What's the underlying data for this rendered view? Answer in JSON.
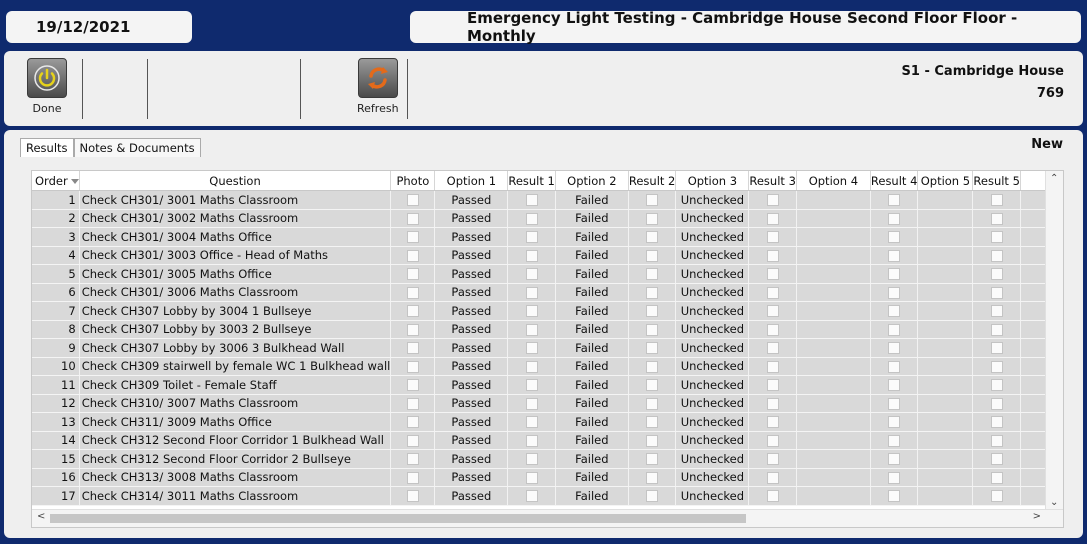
{
  "header": {
    "date": "19/12/2021",
    "title": "Emergency Light Testing - Cambridge House Second Floor Floor - Monthly"
  },
  "toolbar": {
    "done_label": "Done",
    "refresh_label": "Refresh",
    "site_name": "S1 - Cambridge House",
    "site_number": "769"
  },
  "tabs": [
    "Results",
    "Notes & Documents"
  ],
  "new_label": "New",
  "grid": {
    "columns": [
      "Order",
      "Question",
      "Photo",
      "Option 1",
      "Result 1",
      "Option 2",
      "Result 2",
      "Option 3",
      "Result 3",
      "Option 4",
      "Result 4",
      "Option 5",
      "Result 5"
    ],
    "rows": [
      {
        "order": "1",
        "question": "Check CH301/ 3001 Maths Classroom",
        "option1": "Passed",
        "option2": "Failed",
        "option3": "Unchecked"
      },
      {
        "order": "2",
        "question": "Check CH301/ 3002 Maths Classroom",
        "option1": "Passed",
        "option2": "Failed",
        "option3": "Unchecked"
      },
      {
        "order": "3",
        "question": "Check CH301/ 3004 Maths Office",
        "option1": "Passed",
        "option2": "Failed",
        "option3": "Unchecked"
      },
      {
        "order": "4",
        "question": "Check CH301/ 3003 Office - Head of Maths",
        "option1": "Passed",
        "option2": "Failed",
        "option3": "Unchecked"
      },
      {
        "order": "5",
        "question": "Check CH301/ 3005 Maths Office",
        "option1": "Passed",
        "option2": "Failed",
        "option3": "Unchecked"
      },
      {
        "order": "6",
        "question": "Check CH301/ 3006 Maths Classroom",
        "option1": "Passed",
        "option2": "Failed",
        "option3": "Unchecked"
      },
      {
        "order": "7",
        "question": "Check CH307 Lobby by 3004 1 Bullseye",
        "option1": "Passed",
        "option2": "Failed",
        "option3": "Unchecked"
      },
      {
        "order": "8",
        "question": "Check CH307 Lobby by 3003 2 Bullseye",
        "option1": "Passed",
        "option2": "Failed",
        "option3": "Unchecked"
      },
      {
        "order": "9",
        "question": "Check CH307 Lobby by 3006 3 Bulkhead Wall",
        "option1": "Passed",
        "option2": "Failed",
        "option3": "Unchecked"
      },
      {
        "order": "10",
        "question": "Check CH309 stairwell by female  WC 1 Bulkhead wall",
        "option1": "Passed",
        "option2": "Failed",
        "option3": "Unchecked"
      },
      {
        "order": "11",
        "question": "Check CH309 Toilet - Female Staff",
        "option1": "Passed",
        "option2": "Failed",
        "option3": "Unchecked"
      },
      {
        "order": "12",
        "question": "Check CH310/ 3007 Maths Classroom",
        "option1": "Passed",
        "option2": "Failed",
        "option3": "Unchecked"
      },
      {
        "order": "13",
        "question": "Check CH311/ 3009 Maths Office",
        "option1": "Passed",
        "option2": "Failed",
        "option3": "Unchecked"
      },
      {
        "order": "14",
        "question": "Check CH312 Second Floor Corridor 1 Bulkhead Wall",
        "option1": "Passed",
        "option2": "Failed",
        "option3": "Unchecked"
      },
      {
        "order": "15",
        "question": "Check CH312 Second Floor Corridor 2 Bullseye",
        "option1": "Passed",
        "option2": "Failed",
        "option3": "Unchecked"
      },
      {
        "order": "16",
        "question": "Check CH313/ 3008 Maths Classroom",
        "option1": "Passed",
        "option2": "Failed",
        "option3": "Unchecked"
      },
      {
        "order": "17",
        "question": "Check CH314/ 3011 Maths Classroom",
        "option1": "Passed",
        "option2": "Failed",
        "option3": "Unchecked"
      }
    ]
  },
  "colors": {
    "background": "#0f2a6e",
    "row_fill": "#d9d9d9",
    "refresh_orange": "#e46a1a"
  }
}
